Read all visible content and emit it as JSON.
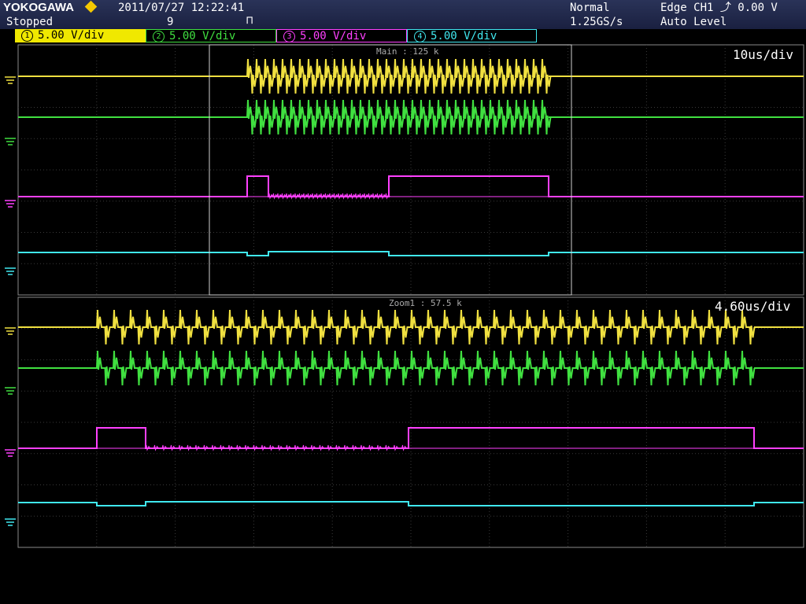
{
  "header": {
    "brand": "YOKOGAWA",
    "datetime": "2011/07/27 12:22:41",
    "status": "Stopped",
    "acq_count": "9",
    "mode": "Normal",
    "sample_rate": "1.25GS/s",
    "trigger": "Edge CH1 ⤴ 0.00 V",
    "trigger_level_mode": "Auto Level"
  },
  "channels": [
    {
      "num": "1",
      "scale": "5.00 V/div",
      "color": "#f0e040",
      "bg": "#f0e800",
      "fg": "#000"
    },
    {
      "num": "2",
      "scale": "5.00 V/div",
      "color": "#40e040",
      "bg": "#000",
      "fg": "#40e040"
    },
    {
      "num": "3",
      "scale": "5.00 V/div",
      "color": "#ff40ff",
      "bg": "#000",
      "fg": "#ff40ff"
    },
    {
      "num": "4",
      "scale": "5.00 V/div",
      "color": "#40e8f0",
      "bg": "#000",
      "fg": "#40e8f0"
    }
  ],
  "main": {
    "timebase": "10us/div",
    "label": "Main : 125 k"
  },
  "zoom": {
    "timebase": "4.60us/div",
    "label": "Zoom1 : 57.5 k"
  },
  "colors": {
    "grid": "#3a3a3a",
    "frame": "#8a8a8a",
    "zoombox": "#d0d0d0"
  }
}
